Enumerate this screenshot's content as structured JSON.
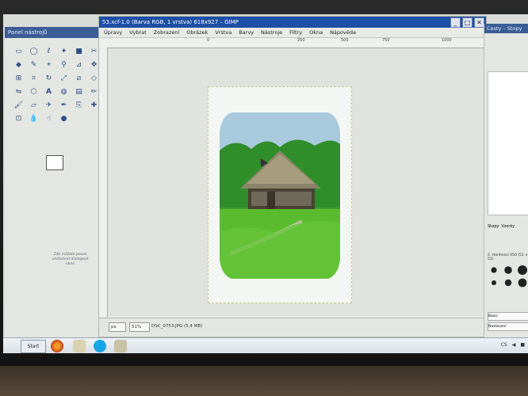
{
  "toolbox": {
    "title": "Panel nástrojů",
    "hint_text": "Zde můžete pouze ukotvovat dialogové okno"
  },
  "image_window": {
    "title": "53.xcf-1.0 (Barva RGB, 1 vrstva) 618x927 – GIMP",
    "window_buttons": [
      "_",
      "□",
      "✕"
    ],
    "menu": [
      "Úpravy",
      "Vybrat",
      "Zobrazení",
      "Obrázek",
      "Vrstva",
      "Barvy",
      "Nástroje",
      "Filtry",
      "Okna",
      "Nápověda"
    ],
    "ruler_labels": [
      "0",
      "250",
      "500",
      "750",
      "1000"
    ],
    "status": {
      "unit": "px",
      "zoom": "51%",
      "file": "DSC_0753.JPG (5,4 MB)"
    }
  },
  "dock": {
    "title": "Cesty – Stopy",
    "tabs": [
      "Stopy",
      "Vzorky"
    ],
    "brush_label": "2. Hardness 050 (51 × 51)",
    "field_label": "Basic",
    "combo": "Nastavení"
  },
  "taskbar": {
    "start_label": "Start",
    "tray": [
      "CS",
      "◀",
      "■"
    ]
  },
  "colors": {
    "title_blue": "#1d4fa6",
    "panel_gray": "#e4e6e2",
    "foreground": "#ffffff",
    "background": "#111111"
  }
}
